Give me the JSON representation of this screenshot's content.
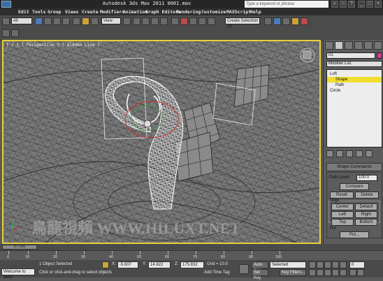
{
  "window": {
    "title": "Autodesk 3ds Max  2011       0001.max",
    "search_placeholder": "Type a keyword or phrase",
    "search_icon": "binoculars-icon",
    "help_icon": "help-icon"
  },
  "menu": [
    "Edit",
    "Tools",
    "Group",
    "Views",
    "Create",
    "Modifiers",
    "Animation",
    "Graph Editors",
    "Rendering",
    "Customize",
    "MAXScript",
    "Help"
  ],
  "toolbar": {
    "selection_filter": "All",
    "view_dropdown": "View",
    "snap_value": "3",
    "selection_set_placeholder": "Create Selection Se"
  },
  "viewport": {
    "label": "[ + ] [ Perspective ] [ Hidden Line ]",
    "watermark": "鳥龍視頻 WWW.HILUXT.NET"
  },
  "command_panel": {
    "object_name": "01",
    "object_color": "#d83a9a",
    "modifier_list": "Modifier List",
    "stack": [
      {
        "label": "Loft",
        "indent": 0,
        "selected": false
      },
      {
        "label": "Shape",
        "indent": 1,
        "selected": true
      },
      {
        "label": "Path",
        "indent": 1,
        "selected": false
      },
      {
        "label": "Circle",
        "indent": 0,
        "selected": false
      }
    ],
    "rollout_title": "Shape Commands",
    "path_level_label": "Path Level:",
    "path_level_value": "100.0",
    "compare": "Compare",
    "reset": "Reset",
    "delete": "Delete",
    "align_label": "Align",
    "center": "Center",
    "default": "Default",
    "left": "Left",
    "right": "Right",
    "top": "Top",
    "bottom": "Bottom",
    "put_label": "Put",
    "put_button": "Put..."
  },
  "timeline": {
    "frame_display": "0 / 100",
    "ticks": [
      "0",
      "10",
      "20",
      "30",
      "40",
      "50",
      "60",
      "70",
      "80",
      "90",
      "100"
    ]
  },
  "status": {
    "welcome": "Welcome to MAX",
    "objects_selected": "1 Object Selected",
    "prompt": "Click or click-and-drag to select objects",
    "x_label": "X:",
    "x_value": "-5.607",
    "y_label": "Y:",
    "y_value": "14.822",
    "z_label": "Z:",
    "z_value": "175.832",
    "grid": "Grid = 10.0",
    "add_time_tag": "Add Time Tag",
    "auto_key": "Auto Key",
    "selected": "Selected",
    "set_key": "Set Key",
    "key_filters": "Key Filters...",
    "frame": "0",
    "accent": "#f1de2e"
  }
}
